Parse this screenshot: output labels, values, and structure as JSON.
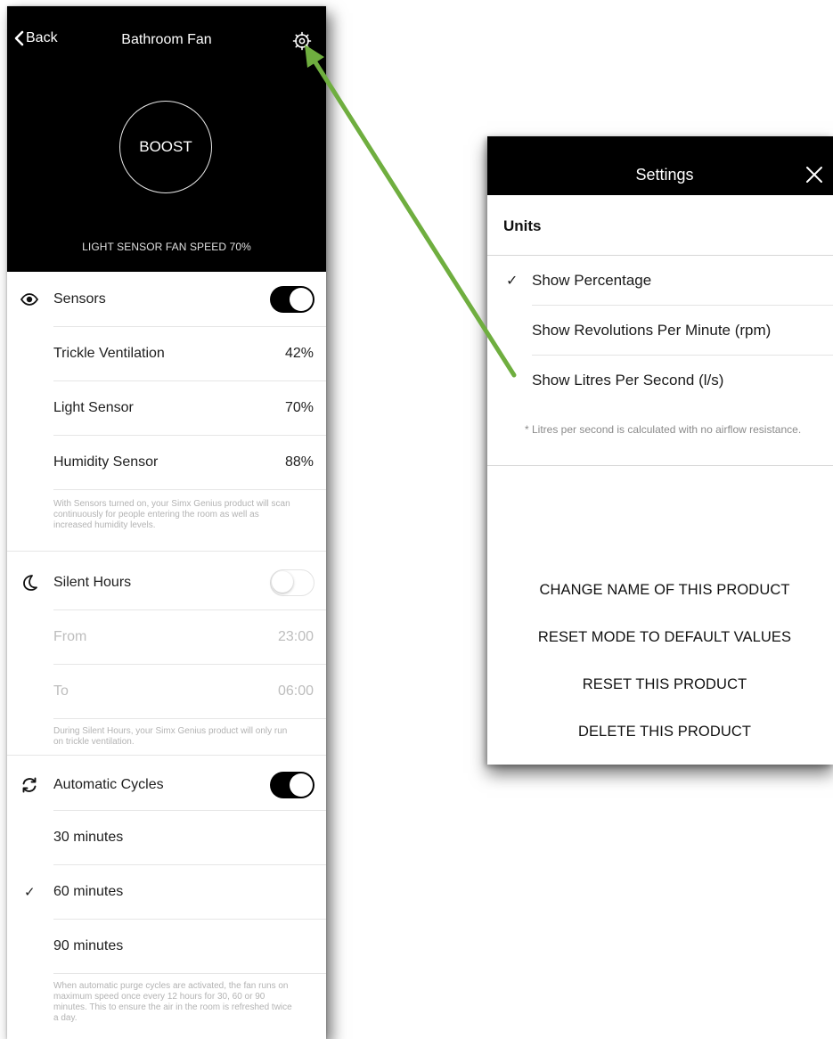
{
  "app": {
    "header": {
      "back_label": "Back",
      "title": "Bathroom Fan"
    },
    "boost_label": "BOOST",
    "status_text": "LIGHT SENSOR FAN SPEED 70%",
    "sensors": {
      "label": "Sensors",
      "enabled": true,
      "items": [
        {
          "label": "Trickle Ventilation",
          "value": "42%"
        },
        {
          "label": "Light Sensor",
          "value": "70%"
        },
        {
          "label": "Humidity Sensor",
          "value": "88%"
        }
      ],
      "note": "With Sensors turned on, your Simx Genius product will scan continuously for people entering the room as well as increased humidity levels."
    },
    "silent_hours": {
      "label": "Silent Hours",
      "enabled": false,
      "from_label": "From",
      "from_value": "23:00",
      "to_label": "To",
      "to_value": "06:00",
      "note": "During Silent Hours, your Simx Genius product will only run on trickle ventilation."
    },
    "automatic_cycles": {
      "label": "Automatic Cycles",
      "enabled": true,
      "options": [
        {
          "label": "30 minutes",
          "selected": false
        },
        {
          "label": "60 minutes",
          "selected": true
        },
        {
          "label": "90 minutes",
          "selected": false
        }
      ],
      "note": "When automatic purge cycles are activated, the fan runs on maximum speed once every 12 hours for 30, 60 or 90 minutes. This to ensure the air in the room is refreshed twice a day."
    }
  },
  "settings": {
    "title": "Settings",
    "units_heading": "Units",
    "options": [
      {
        "label": "Show Percentage",
        "selected": true
      },
      {
        "label": "Show Revolutions Per Minute (rpm)",
        "selected": false
      },
      {
        "label": "Show Litres Per Second (l/s)",
        "selected": false
      }
    ],
    "note": "* Litres per second is calculated with no airflow resistance.",
    "actions": [
      "CHANGE NAME OF THIS PRODUCT",
      "RESET MODE TO DEFAULT VALUES",
      "RESET THIS PRODUCT",
      "DELETE THIS PRODUCT"
    ]
  },
  "colors": {
    "accent_arrow": "#6fae3f",
    "header_bg": "#000000"
  },
  "icons": [
    "chevron-left-icon",
    "gear-icon",
    "eye-icon",
    "moon-icon",
    "cycle-icon",
    "checkmark-icon",
    "close-icon"
  ]
}
